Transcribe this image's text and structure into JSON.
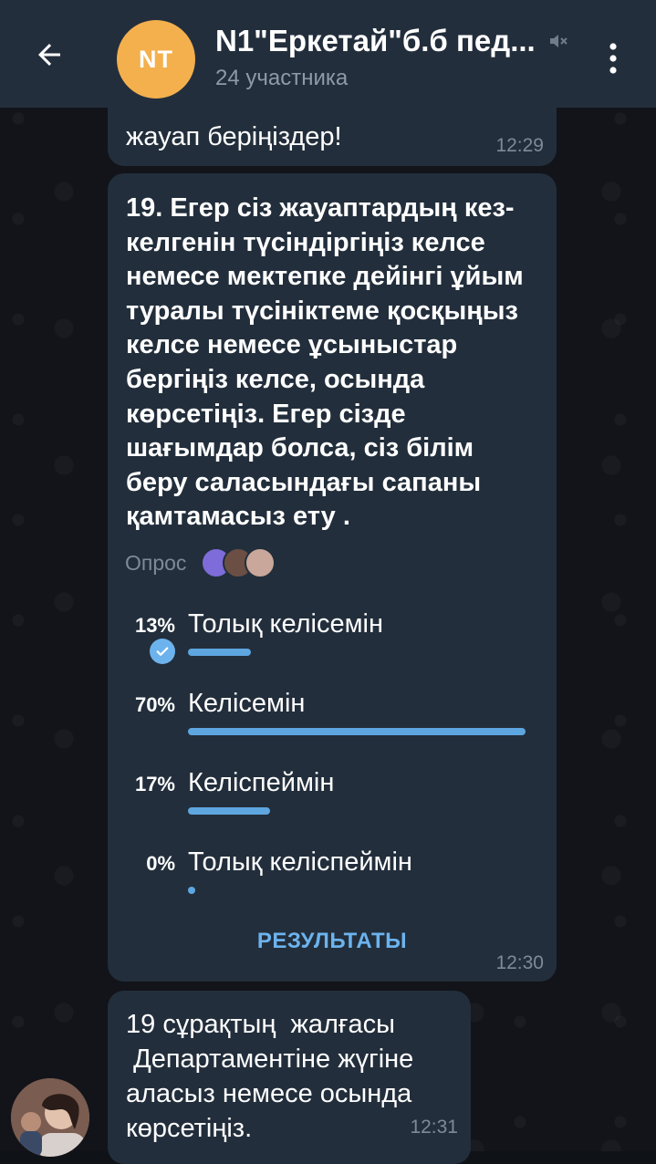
{
  "header": {
    "avatar_initials": "NT",
    "avatar_color": "#f3b04d",
    "title": "N1\"Еркетай\"б.б пед...",
    "subtitle": "24 участника",
    "back_icon": "arrow-left-icon",
    "mute_icon": "muted-speaker-icon",
    "menu_icon": "more-vertical-icon"
  },
  "messages": [
    {
      "text": "жауап беріңіздер!",
      "time": "12:29"
    },
    {
      "poll": {
        "question": "19. Егер сіз жауаптардың кез-келгенін түсіндіргіңіз келсе немесе мектепке дейінгі ұйым туралы түсініктеме қосқыңыз келсе немесе ұсыныстар бергіңіз келсе, осында көрсетіңіз. Егер сізде шағымдар болса, сіз білім беру саласындағы сапаны қамтамасыз ету .",
        "type_label": "Опрос",
        "options": [
          {
            "percent_label": "13%",
            "label": "Толық келісемін",
            "fraction": 0.13,
            "chosen": true
          },
          {
            "percent_label": "70%",
            "label": "Келісемін",
            "fraction": 0.7,
            "chosen": false
          },
          {
            "percent_label": "17%",
            "label": "Келіспеймін",
            "fraction": 0.17,
            "chosen": false
          },
          {
            "percent_label": "0%",
            "label": "Толық келіспеймін",
            "fraction": 0.0,
            "chosen": false
          }
        ],
        "results_label": "РЕЗУЛЬТАТЫ",
        "bar_color": "#5ea6e0",
        "accent_color": "#6cb3ee"
      },
      "time": "12:30"
    },
    {
      "text": "19 сұрақтың  жалғасы\n Департаментіне жүгіне аласыз немесе осында көрсетіңіз.",
      "time": "12:31"
    }
  ]
}
